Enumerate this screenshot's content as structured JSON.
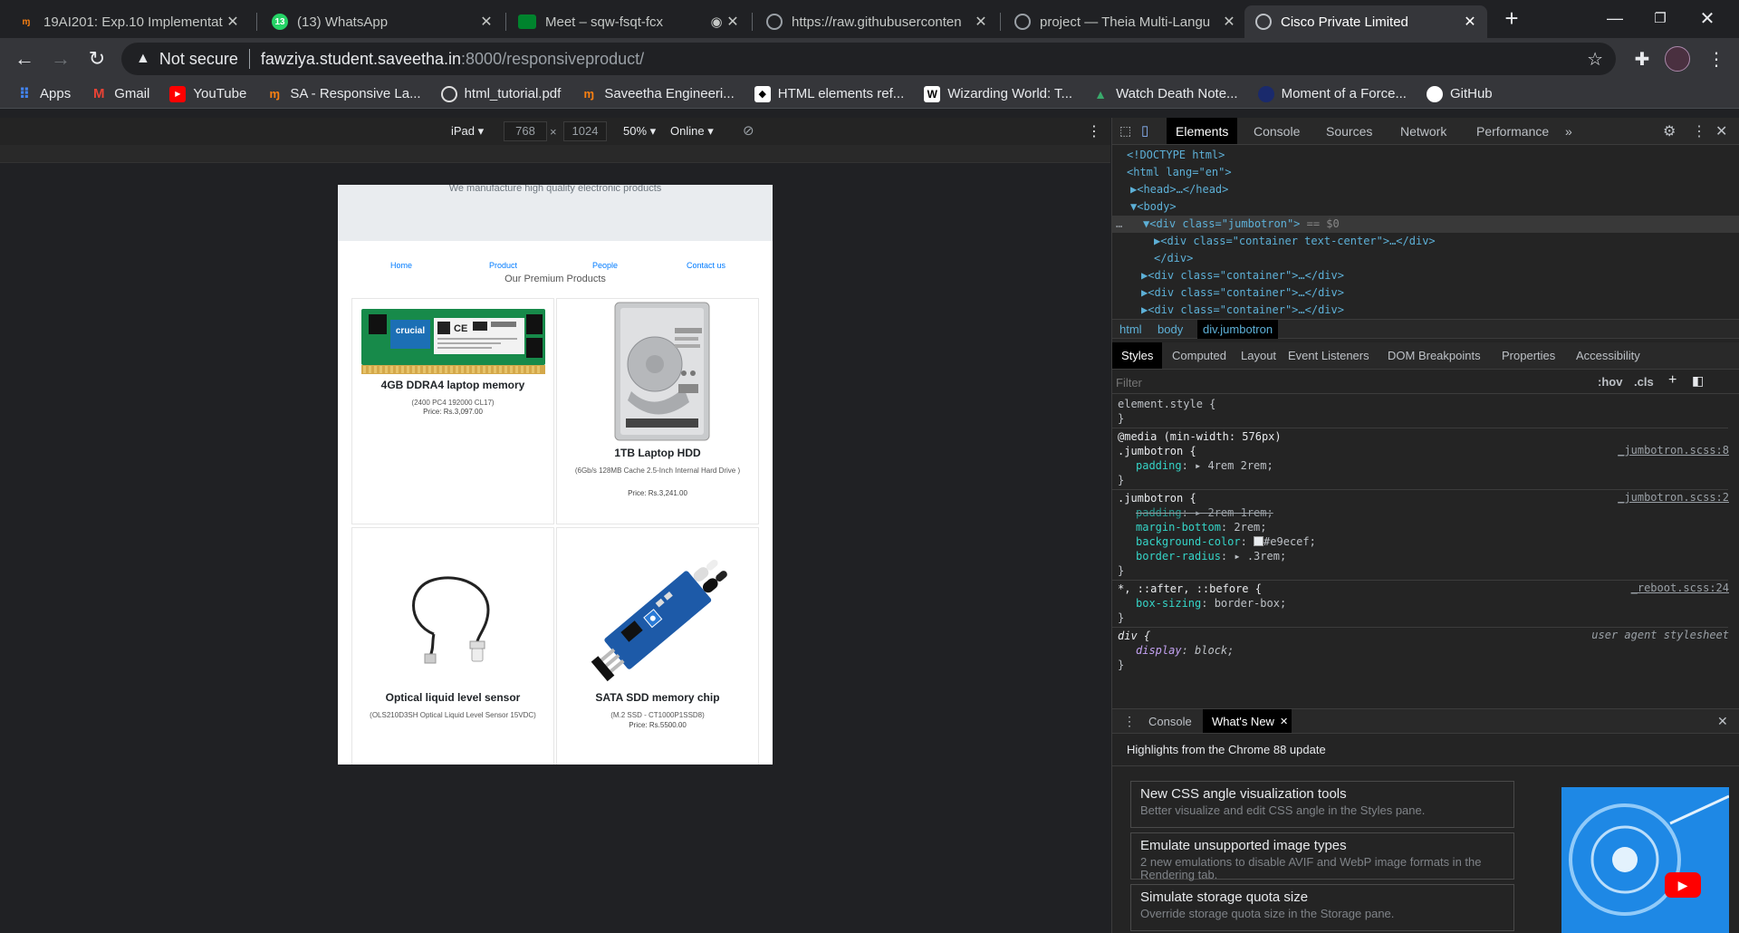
{
  "tabs": [
    {
      "title": "19AI201: Exp.10 Implementat",
      "icon": "moodle-icon",
      "active": false
    },
    {
      "title": "(13) WhatsApp",
      "icon": "whatsapp-icon",
      "active": false
    },
    {
      "title": "Meet – sqw-fsqt-fcx",
      "icon": "meet-icon",
      "active": false
    },
    {
      "title": "https://raw.githubuserconten",
      "icon": "globe-icon",
      "active": false
    },
    {
      "title": "project — Theia Multi-Langu",
      "icon": "globe-icon",
      "active": false
    },
    {
      "title": "Cisco Private Limited",
      "icon": "globe-icon",
      "active": true
    }
  ],
  "whatsapp_badge": "13",
  "address": {
    "security": "Not secure",
    "host": "fawziya.student.saveetha.in",
    "path": ":8000/responsiveproduct/"
  },
  "bookmarks": [
    {
      "label": "Apps",
      "icon": "apps-grid-icon"
    },
    {
      "label": "Gmail",
      "icon": "gmail-icon"
    },
    {
      "label": "YouTube",
      "icon": "youtube-icon"
    },
    {
      "label": "SA - Responsive La...",
      "icon": "moodle-icon"
    },
    {
      "label": "html_tutorial.pdf",
      "icon": "pdf-icon"
    },
    {
      "label": "Saveetha Engineeri...",
      "icon": "moodle-icon"
    },
    {
      "label": "HTML elements ref...",
      "icon": "mdn-icon"
    },
    {
      "label": "Wizarding World: T...",
      "icon": "w-icon"
    },
    {
      "label": "Watch Death Note...",
      "icon": "deathnote-icon"
    },
    {
      "label": "Moment of a Force...",
      "icon": "dot-icon"
    },
    {
      "label": "GitHub",
      "icon": "github-icon"
    }
  ],
  "device": {
    "name": "iPad",
    "width": "768",
    "height": "1024",
    "zoom": "50%",
    "network": "Online"
  },
  "site": {
    "tagline": "We manufacture high quality electronic products",
    "nav": [
      "Home",
      "Product",
      "People",
      "Contact us"
    ],
    "section_title": "Our Premium Products",
    "products": [
      {
        "name": "4GB DDRA4 laptop memory",
        "desc": "(2400 PC4 192000 CL17)",
        "price": "Price: Rs.3,097.00",
        "ram_label": "crucial"
      },
      {
        "name": "1TB Laptop HDD",
        "desc": "(6Gb/s 128MB Cache 2.5-Inch Internal Hard Drive )",
        "price": "Price: Rs.3,241.00"
      },
      {
        "name": "Optical liquid level sensor",
        "desc": "(OLS210D3SH Optical Liquid Level Sensor 15VDC)",
        "price": ""
      },
      {
        "name": "SATA SDD memory chip",
        "desc": "(M.2 SSD - CT1000P1SSD8)",
        "price": "Price: Rs.5500.00"
      }
    ]
  },
  "devtools": {
    "tabs": [
      "Elements",
      "Console",
      "Sources",
      "Network",
      "Performance"
    ],
    "more": "»",
    "dom": [
      {
        "indent": 0,
        "text_parts": [
          "<!DOCTYPE html>"
        ]
      },
      {
        "indent": 0,
        "text_parts": [
          "<html lang=\"en\">"
        ]
      },
      {
        "indent": 1,
        "text_parts": [
          "▶<head>…</head>"
        ]
      },
      {
        "indent": 1,
        "text_parts": [
          "▼<body>"
        ]
      },
      {
        "indent": 2,
        "text_parts": [
          "▼<div class=\"jumbotron\">",
          " == $0"
        ]
      },
      {
        "indent": 3,
        "text_parts": [
          "▶<div class=\"container text-center\">…</div>"
        ]
      },
      {
        "indent": 3,
        "text_parts": [
          "</div>"
        ]
      },
      {
        "indent": 2,
        "text_parts": [
          "▶<div class=\"container\">…</div>"
        ]
      },
      {
        "indent": 2,
        "text_parts": [
          "▶<div class=\"container\">…</div>"
        ]
      },
      {
        "indent": 2,
        "text_parts": [
          "▶<div class=\"container\">…</div>"
        ]
      }
    ],
    "breadcrumbs": [
      "html",
      "body",
      "div.jumbotron"
    ],
    "styles_tabs": [
      "Styles",
      "Computed",
      "Layout",
      "Event Listeners",
      "DOM Breakpoints",
      "Properties",
      "Accessibility"
    ],
    "filter_placeholder": "Filter",
    "hov": ":hov",
    "cls": ".cls",
    "rules": {
      "element_style": "element.style {",
      "media": "@media (min-width: 576px)",
      "jumbo1_sel": ".jumbotron {",
      "jumbo1_prop": "padding",
      "jumbo1_val": "4rem 2rem;",
      "jumbo1_src": "_jumbotron.scss:8",
      "jumbo2_sel": ".jumbotron {",
      "jumbo2_src": "_jumbotron.scss:2",
      "jumbo2_p1": "padding",
      "jumbo2_v1": "2rem 1rem;",
      "jumbo2_p2": "margin-bottom",
      "jumbo2_v2": "2rem;",
      "jumbo2_p3": "background-color",
      "jumbo2_v3": "#e9ecef;",
      "jumbo2_p4": "border-radius",
      "jumbo2_v4": ".3rem;",
      "star_sel": "*, ::after, ::before {",
      "star_src": "_reboot.scss:24",
      "star_prop": "box-sizing",
      "star_val": "border-box;",
      "div_sel": "div {",
      "div_src": "user agent stylesheet",
      "div_prop": "display",
      "div_val": "block;",
      "close": "}"
    },
    "drawer_tabs": [
      "Console",
      "What's New"
    ],
    "whats_new_heading": "Highlights from the Chrome 88 update",
    "whats_new": [
      {
        "title": "New CSS angle visualization tools",
        "desc": "Better visualize and edit CSS angle in the Styles pane."
      },
      {
        "title": "Emulate unsupported image types",
        "desc": "2 new emulations to disable AVIF and WebP image formats in the Rendering tab."
      },
      {
        "title": "Simulate storage quota size",
        "desc": "Override storage quota size in the Storage pane."
      }
    ]
  },
  "colors": {
    "link": "#007bff",
    "jumbotron_bg": "#e9ecef",
    "devtools_selected_tab": "#000000"
  }
}
